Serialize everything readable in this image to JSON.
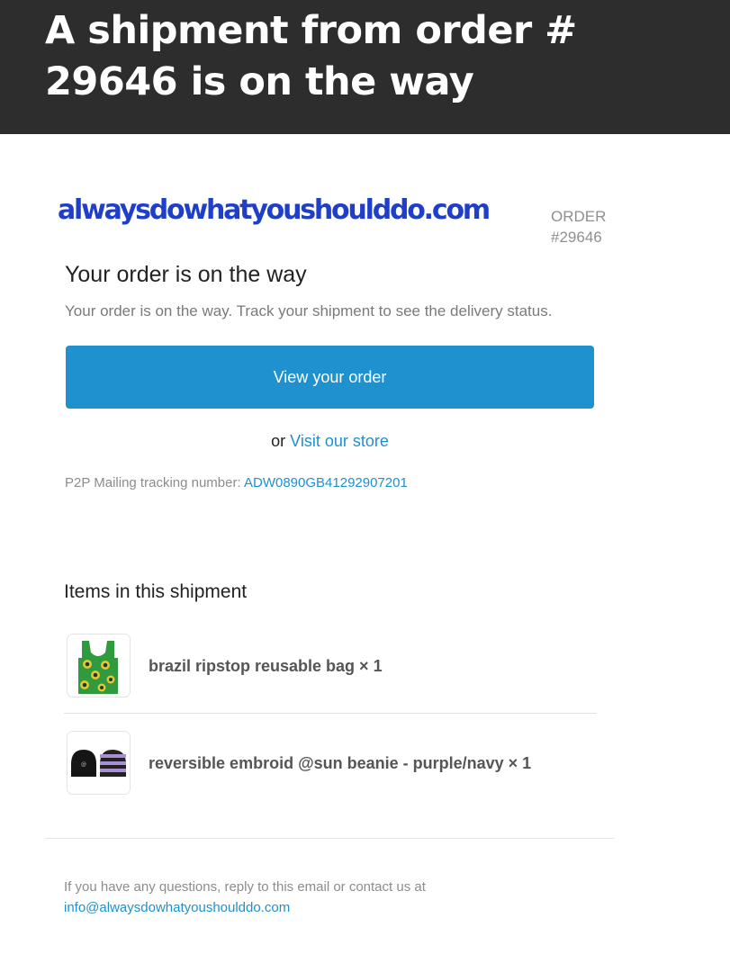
{
  "header": {
    "title": "A shipment from order # 29646 is on the way"
  },
  "email": {
    "logo_text": "alwaysdowhatyoushoulddo.com",
    "order_label": "ORDER",
    "order_number": "#29646",
    "heading": "Your order is on the way",
    "subtext": "Your order is on the way. Track your shipment to see the delivery status.",
    "view_order_button": "View your order",
    "or_text": "or",
    "visit_store_link": "Visit our store",
    "tracking_label": "P2P Mailing tracking number:",
    "tracking_number": "ADW0890GB41292907201",
    "items_heading": "Items in this shipment",
    "items": [
      {
        "title": "brazil ripstop reusable bag × 1",
        "thumbnail": "bag-product-image"
      },
      {
        "title": "reversible embroid @sun beanie - purple/navy × 1",
        "thumbnail": "beanie-product-image"
      }
    ],
    "footer_text": "If you have any questions, reply to this email or contact us at",
    "footer_email": "info@alwaysdowhatyoushoulddo.com"
  },
  "colors": {
    "header_bg": "#2d2d2e",
    "logo": "#1f3ec9",
    "accent": "#1e91ce"
  }
}
